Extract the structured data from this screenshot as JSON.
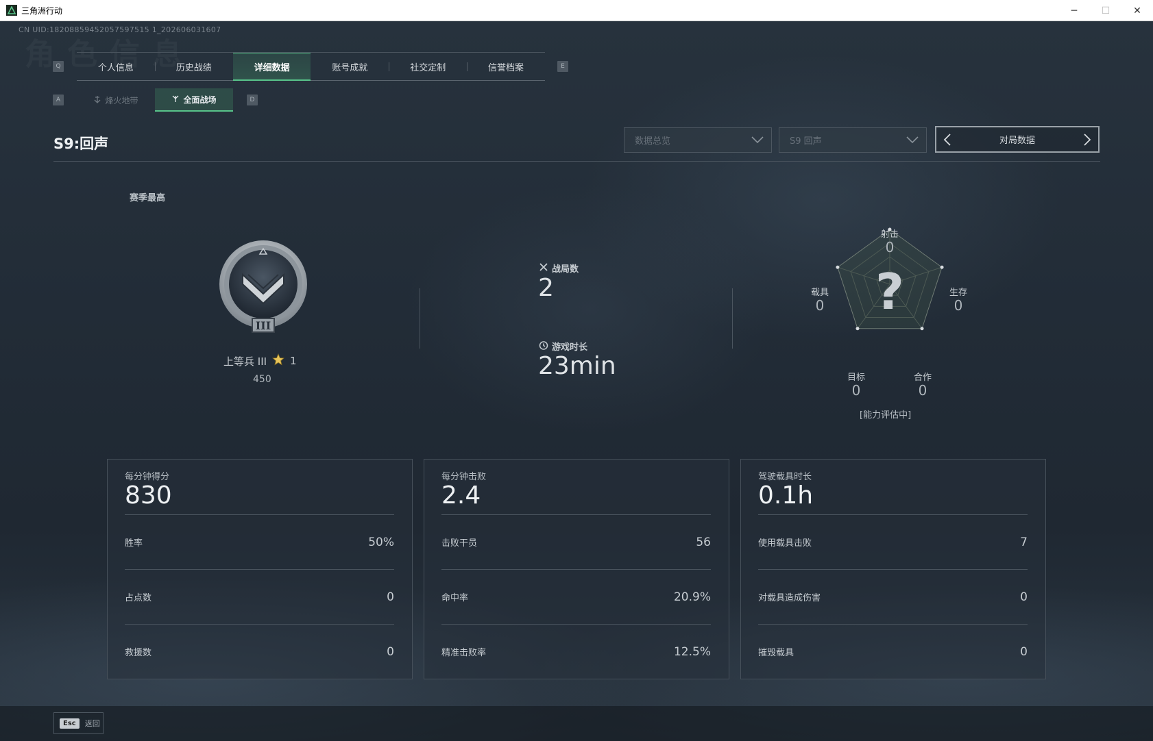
{
  "window": {
    "title": "三角洲行动",
    "minimize": "─",
    "maximize": "☐",
    "close": "✕"
  },
  "uid": "CN UID:18208859452057597515 1_202606031607",
  "tabs_hint_left": "Q",
  "tabs_hint_right": "E",
  "tabs": [
    {
      "label": "个人信息"
    },
    {
      "label": "历史战绩"
    },
    {
      "label": "详细数据"
    },
    {
      "label": "账号成就"
    },
    {
      "label": "社交定制"
    },
    {
      "label": "信誉档案"
    }
  ],
  "subtabs_hint_left": "A",
  "subtabs_hint_right": "D",
  "subtabs": [
    {
      "label": "烽火地带"
    },
    {
      "label": "全面战场"
    }
  ],
  "season_title": "S9:回声",
  "filters": {
    "overview": "数据总览",
    "season": "S9 回声",
    "pager_label": "对局数据"
  },
  "rank": {
    "section_label": "赛季最高",
    "name": "上等兵 III",
    "stars": "1",
    "score": "450",
    "badge_roman": "III"
  },
  "summary": {
    "matches_label": "战局数",
    "matches_value": "2",
    "time_label": "游戏时长",
    "time_value": "23min"
  },
  "radar": {
    "axes": [
      {
        "label": "射击",
        "value": "0"
      },
      {
        "label": "生存",
        "value": "0"
      },
      {
        "label": "合作",
        "value": "0"
      },
      {
        "label": "目标",
        "value": "0"
      },
      {
        "label": "载具",
        "value": "0"
      }
    ],
    "center_glyph": "?",
    "status": "[能力评估中]"
  },
  "cards": [
    {
      "head_label": "每分钟得分",
      "head_value": "830",
      "rows": [
        {
          "label": "胜率",
          "value": "50%"
        },
        {
          "label": "占点数",
          "value": "0"
        },
        {
          "label": "救援数",
          "value": "0"
        }
      ]
    },
    {
      "head_label": "每分钟击败",
      "head_value": "2.4",
      "rows": [
        {
          "label": "击败干员",
          "value": "56"
        },
        {
          "label": "命中率",
          "value": "20.9%"
        },
        {
          "label": "精准击败率",
          "value": "12.5%"
        }
      ]
    },
    {
      "head_label": "驾驶载具时长",
      "head_value": "0.1h",
      "rows": [
        {
          "label": "使用载具击败",
          "value": "7"
        },
        {
          "label": "对载具造成伤害",
          "value": "0"
        },
        {
          "label": "摧毁载具",
          "value": "0"
        }
      ]
    }
  ],
  "back": {
    "key": "Esc",
    "label": "返回"
  },
  "colors": {
    "accent": "#58c48a",
    "background": "#222c37"
  }
}
